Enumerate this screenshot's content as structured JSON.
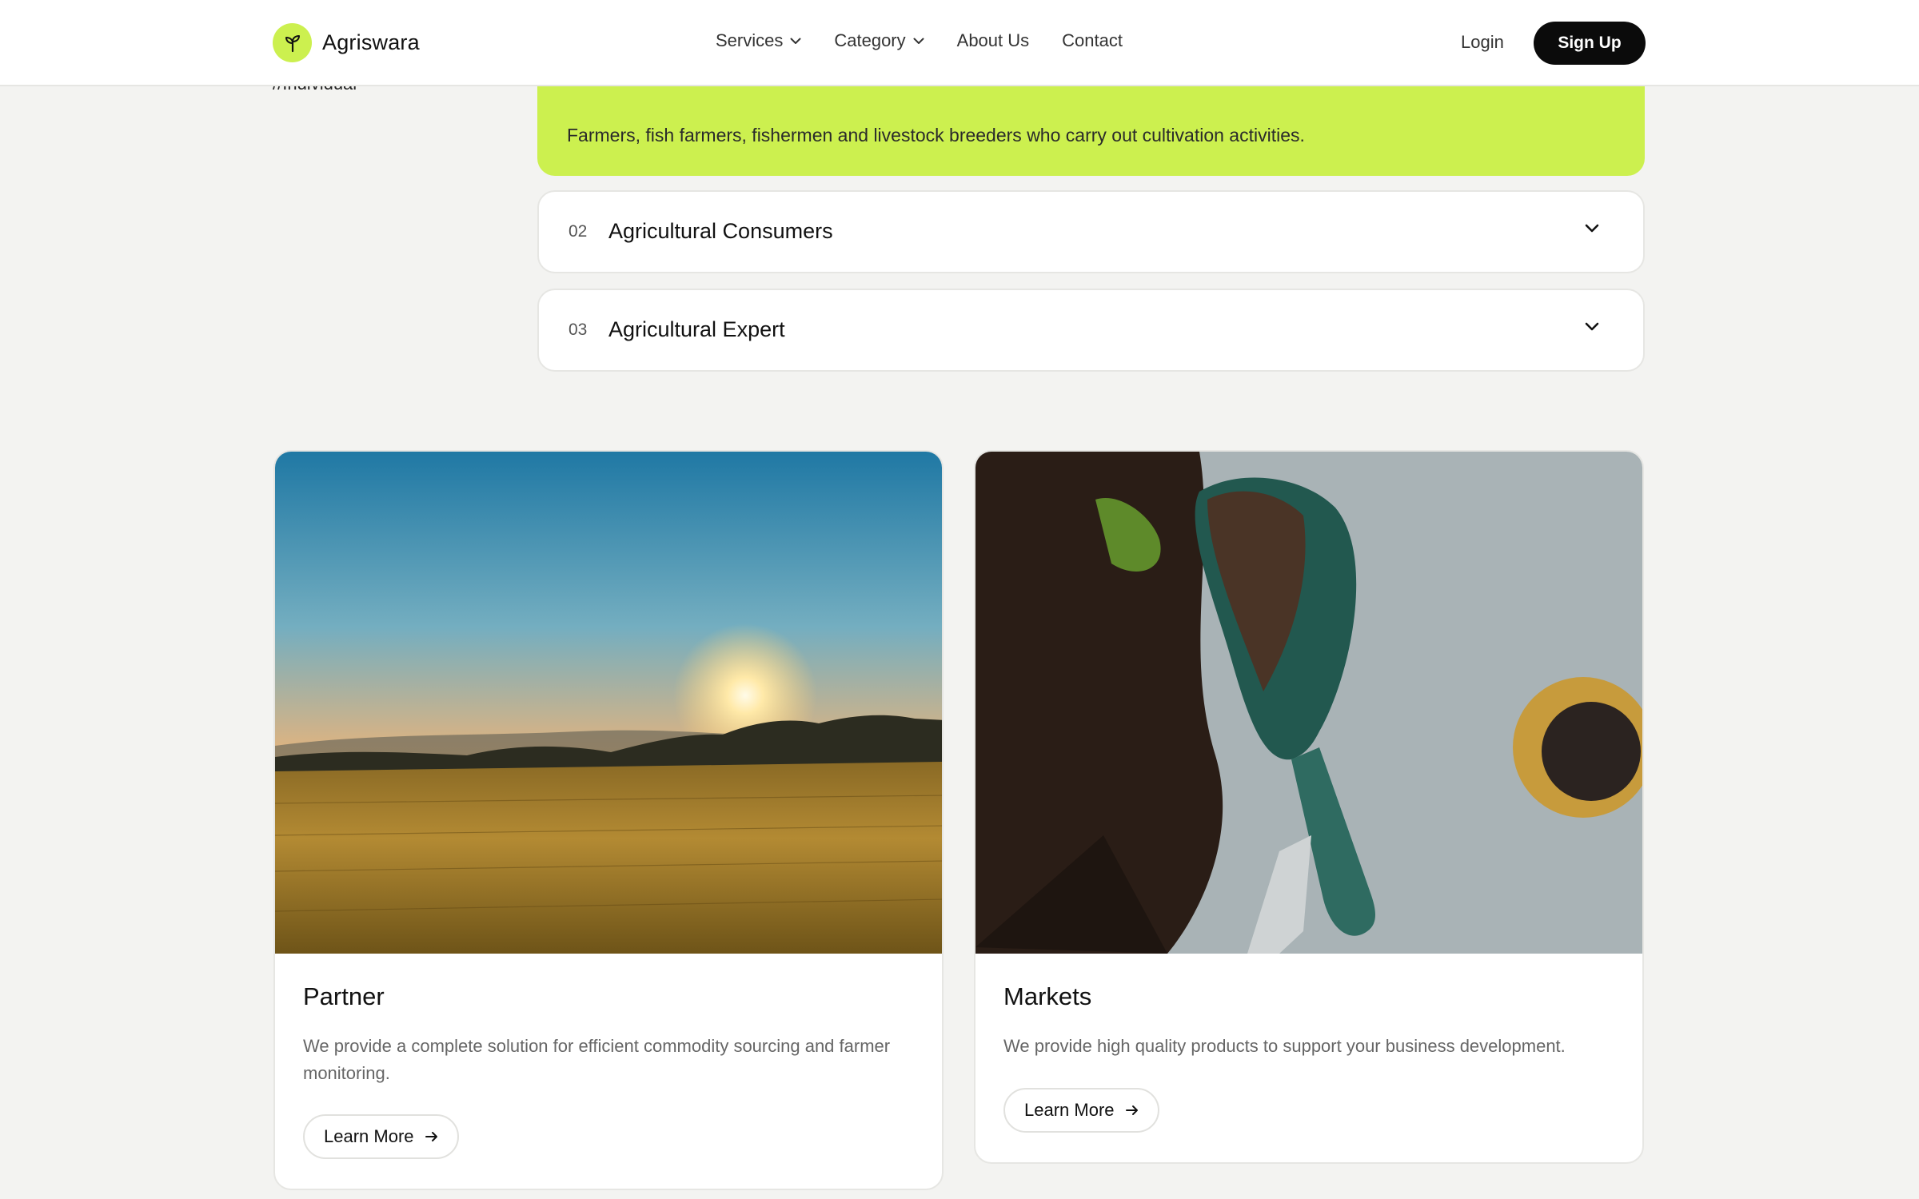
{
  "header": {
    "brand": "Agriswara",
    "nav": [
      {
        "label": "Services",
        "has_dropdown": true
      },
      {
        "label": "Category",
        "has_dropdown": true
      },
      {
        "label": "About Us",
        "has_dropdown": false
      },
      {
        "label": "Contact",
        "has_dropdown": false
      }
    ],
    "login_label": "Login",
    "signup_label": "Sign Up"
  },
  "section": {
    "side_label": "//Individual"
  },
  "accordion": {
    "open_item": {
      "description": "Farmers, fish farmers, fishermen and livestock breeders who carry out cultivation activities."
    },
    "items": [
      {
        "number": "02",
        "title": "Agricultural Consumers"
      },
      {
        "number": "03",
        "title": "Agricultural Expert"
      }
    ]
  },
  "cards": [
    {
      "title": "Partner",
      "description": "We provide a complete solution for efficient commodity sourcing and farmer monitoring.",
      "button_label": "Learn More",
      "image": "wheat-field-sunset-photo"
    },
    {
      "title": "Markets",
      "description": "We provide high quality products to support your business development.",
      "button_label": "Learn More",
      "image": "garden-trowel-soil-photo"
    }
  ],
  "colors": {
    "accent": "#ccf04f",
    "background": "#f3f3f1",
    "button_dark": "#0b0b0b"
  }
}
